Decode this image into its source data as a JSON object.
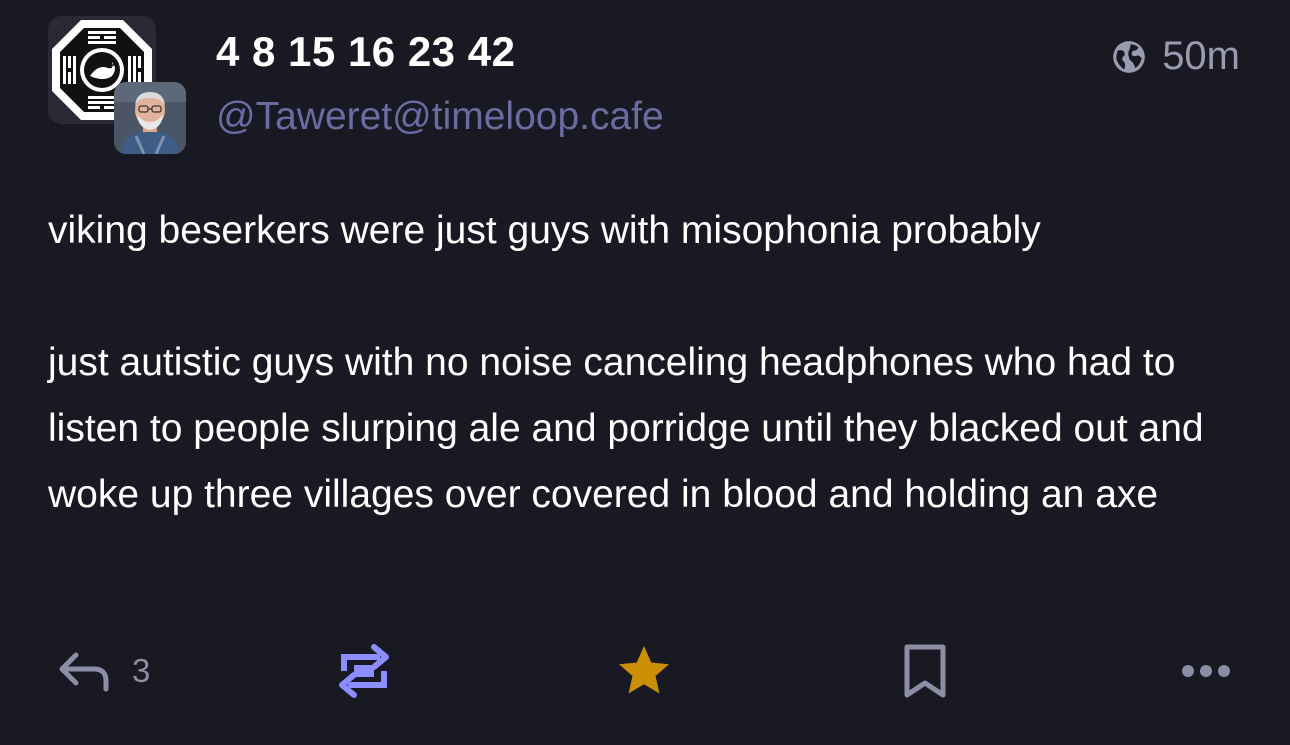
{
  "post": {
    "display_name": "4 8 15 16 23 42",
    "handle": "@Taweret@timeloop.cafe",
    "visibility_icon": "globe-icon",
    "time": "50m",
    "avatar_text": "DHARMA",
    "paragraphs": [
      "viking beserkers were just guys with misophonia probably",
      "just autistic guys with no noise canceling headphones who had to listen to people slurping ale and porridge until they blacked out and woke up three villages over covered in blood and holding an axe"
    ]
  },
  "actions": {
    "reply_icon": "reply-icon",
    "reply_count": "3",
    "boost_icon": "boost-icon",
    "favourite_icon": "star-icon",
    "bookmark_icon": "bookmark-icon",
    "more_icon": "more-icon"
  },
  "colors": {
    "background": "#191923",
    "handle": "#6c6aa0",
    "muted": "#8d8da6",
    "boost_active": "#8c8dff",
    "favourite_active": "#ca8f04"
  }
}
